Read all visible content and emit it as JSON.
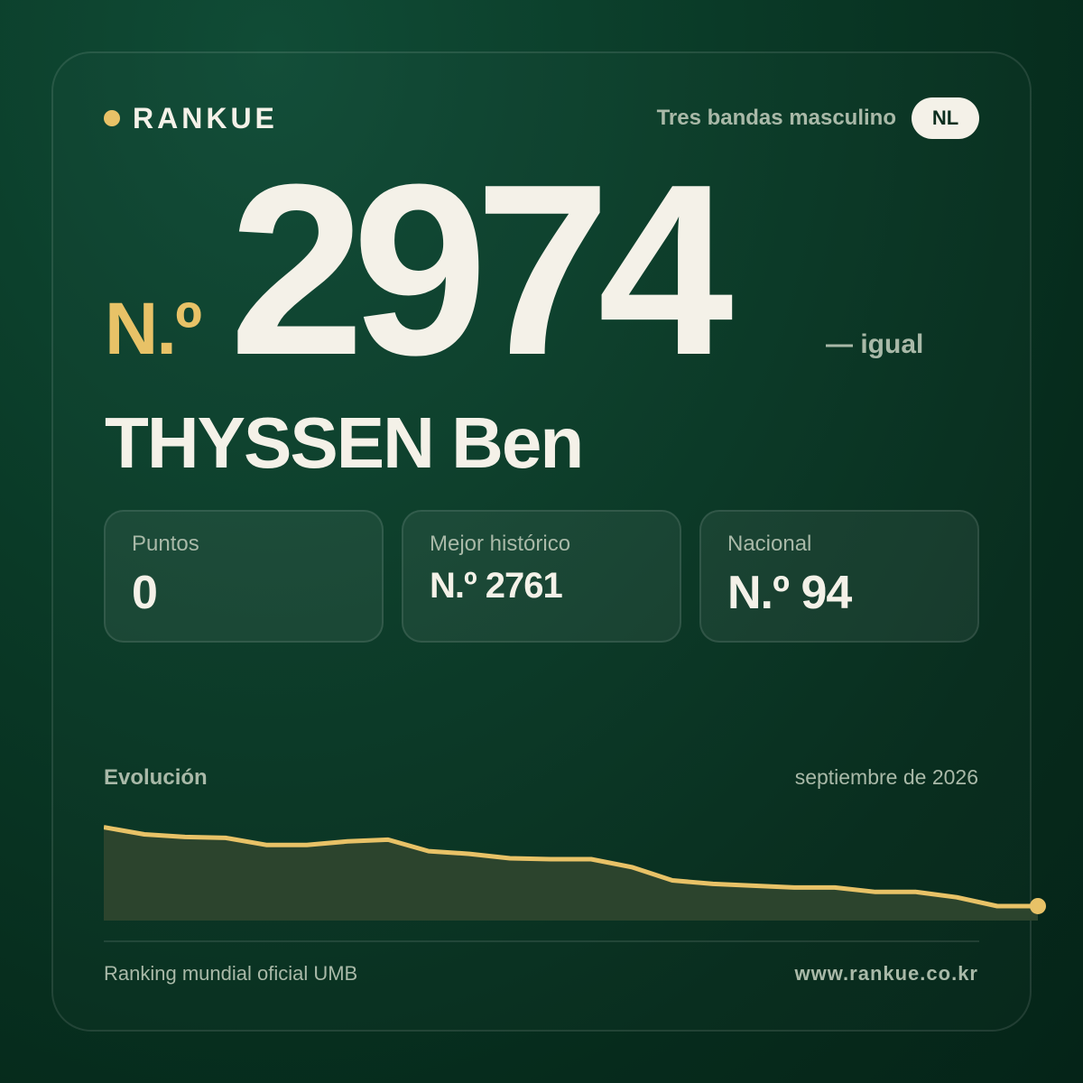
{
  "brand": {
    "name": "RANKUE",
    "accent_color": "#e8c267"
  },
  "header": {
    "category": "Tres bandas masculino",
    "country_code": "NL"
  },
  "rank": {
    "prefix": "N.º",
    "value": "2974",
    "change": "— igual"
  },
  "player": {
    "name": "THYSSEN Ben"
  },
  "stats": [
    {
      "label": "Puntos",
      "value": "0"
    },
    {
      "label": "Mejor histórico",
      "value": "N.º 2761"
    },
    {
      "label": "Nacional",
      "value": "N.º 94"
    }
  ],
  "evolution": {
    "title": "Evolución",
    "date": "septiembre de 2026"
  },
  "chart_data": {
    "type": "area",
    "y_axis": "rank (inverted: higher on screen = better rank)",
    "values": [
      2821,
      2829,
      2832,
      2833,
      2841,
      2841,
      2837,
      2835,
      2848,
      2851,
      2856,
      2857,
      2857,
      2866,
      2881,
      2885,
      2887,
      2889,
      2889,
      2894,
      2894,
      2900,
      2910,
      2910
    ],
    "ylim": [
      2800,
      2920
    ],
    "grid": false,
    "line_color": "#e8c267",
    "fill_color": "#2c442d"
  },
  "footer": {
    "source": "Ranking mundial oficial UMB",
    "website": "www.rankue.co.kr"
  }
}
